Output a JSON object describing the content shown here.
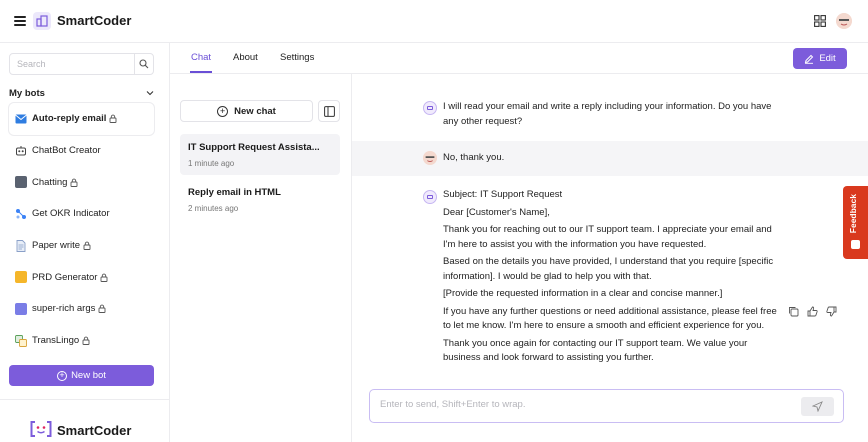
{
  "app": {
    "name": "SmartCoder",
    "footer_name": "SmartCoder"
  },
  "sidebar": {
    "search_placeholder": "Search",
    "section_title": "My bots",
    "bots": [
      {
        "label": "Auto-reply email",
        "locked": true,
        "icon": "mail-icon",
        "color": "#2f7de1",
        "active": true
      },
      {
        "label": "ChatBot Creator",
        "locked": false,
        "icon": "robot-icon",
        "color": "#444444",
        "active": false
      },
      {
        "label": "Chatting",
        "locked": true,
        "icon": "square-icon",
        "color": "#5a6270",
        "active": false
      },
      {
        "label": "Get OKR Indicator",
        "locked": false,
        "icon": "nodes-icon",
        "color": "#3b82f6",
        "active": false
      },
      {
        "label": "Paper write",
        "locked": true,
        "icon": "document-icon",
        "color": "#8aa0c8",
        "active": false
      },
      {
        "label": "PRD Generator",
        "locked": true,
        "icon": "square-icon",
        "color": "#f5b62a",
        "active": false
      },
      {
        "label": "super-rich args",
        "locked": true,
        "icon": "square-icon",
        "color": "#7a7de6",
        "active": false
      },
      {
        "label": "TransLingo",
        "locked": true,
        "icon": "translate-icon",
        "color": "#5aa05a",
        "active": false
      }
    ],
    "new_bot_label": "New bot"
  },
  "tabs": [
    {
      "label": "Chat",
      "active": true
    },
    {
      "label": "About",
      "active": false
    },
    {
      "label": "Settings",
      "active": false
    }
  ],
  "edit_label": "Edit",
  "chat_list": {
    "new_chat_label": "New chat",
    "conversations": [
      {
        "title": "IT Support Request Assista...",
        "time": "1 minute ago",
        "active": true
      },
      {
        "title": "Reply email in HTML",
        "time": "2 minutes ago",
        "active": false
      }
    ]
  },
  "messages": [
    {
      "role": "bot",
      "paragraphs": [
        "I will read your email and write a reply including your information. Do you have any other request?"
      ]
    },
    {
      "role": "user",
      "paragraphs": [
        "No, thank you."
      ]
    },
    {
      "role": "bot",
      "paragraphs": [
        "Subject: IT Support Request",
        "Dear [Customer's Name],",
        "Thank you for reaching out to our IT support team. I appreciate your email and I'm here to assist you with the information you have requested.",
        "Based on the details you have provided, I understand that you require [specific information]. I would be glad to help you with that.",
        "[Provide the requested information in a clear and concise manner.]",
        "If you have any further questions or need additional assistance, please feel free to let me know. I'm here to ensure a smooth and efficient experience for you.",
        "Thank you once again for contacting our IT support team. We value your business and look forward to assisting you further."
      ]
    }
  ],
  "feedback_label": "Feedback",
  "composer": {
    "placeholder": "Enter to send, Shift+Enter to wrap."
  },
  "colors": {
    "accent": "#7c5cdb",
    "feedback": "#d9391e"
  }
}
